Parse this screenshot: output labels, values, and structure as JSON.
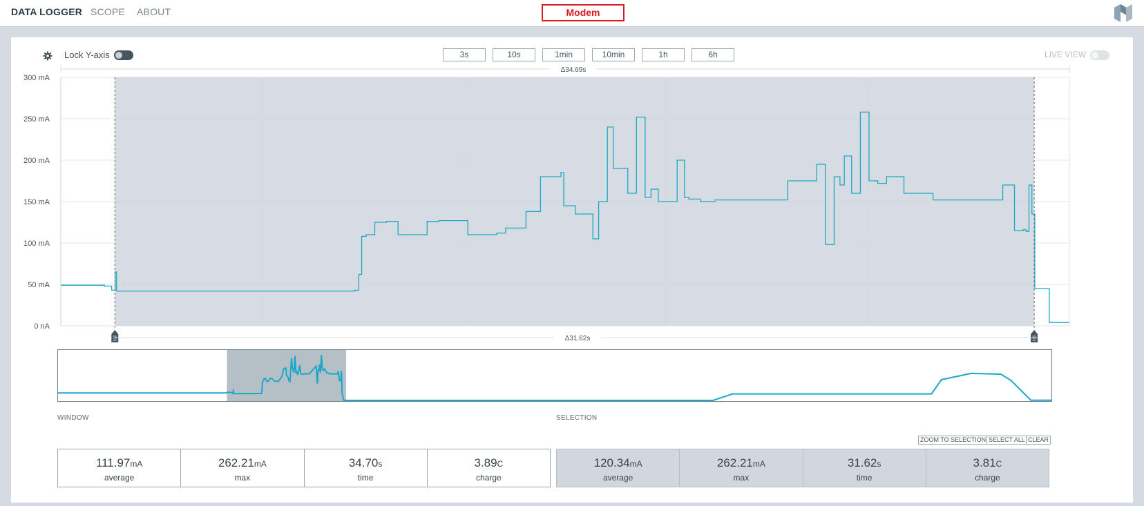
{
  "nav": {
    "items": [
      "DATA LOGGER",
      "SCOPE",
      "ABOUT"
    ],
    "device_name": "Modem"
  },
  "toolbar": {
    "lock_y_label": "Lock Y-axis",
    "live_view_label": "LIVE VIEW",
    "ranges": [
      "3s",
      "10s",
      "1min",
      "10min",
      "1h",
      "6h"
    ],
    "lock_y_on": true,
    "live_view_on": false
  },
  "chart": {
    "window_delta": "Δ34.69s",
    "selection_delta": "Δ31.62s",
    "accent": "#1ba8c8",
    "selection_fill": "#cfd6dc"
  },
  "chart_data": {
    "type": "line",
    "ylabel": "",
    "y_ticks": [
      "300 mA",
      "250 mA",
      "200 mA",
      "150 mA",
      "100 mA",
      "50 mA",
      "0 nA"
    ],
    "ylim": [
      0,
      300
    ],
    "xlim": [
      0,
      34.69
    ],
    "selection": [
      1.86,
      33.48
    ],
    "grid": true,
    "series": [
      {
        "x": [
          0,
          1.5,
          1.6,
          1.75,
          1.84,
          1.87,
          1.92,
          2.2,
          5,
          8,
          10.1,
          10.25,
          10.35,
          10.5,
          10.8,
          11.2,
          11.6,
          12,
          12.6,
          13,
          14,
          15,
          15.3,
          16,
          16.5,
          17.2,
          17.3,
          17.7,
          18.3,
          18.5,
          18.8,
          19,
          19.5,
          19.8,
          20.1,
          20.3,
          20.55,
          20.7,
          21.2,
          21.45,
          21.6,
          22,
          22.5,
          23,
          24,
          25,
          26,
          26.3,
          26.6,
          26.8,
          26.95,
          27.2,
          27.5,
          27.8,
          28.1,
          28.4,
          29,
          30,
          31,
          32,
          32.3,
          32.4,
          32.8,
          33.1,
          33.2,
          33.3,
          33.4,
          33.5,
          34,
          34.69
        ],
        "y": [
          49,
          48,
          48,
          43,
          43,
          65,
          42,
          42,
          42,
          42,
          43,
          62,
          108,
          110,
          125,
          126,
          110,
          110,
          126,
          127,
          110,
          112,
          118,
          138,
          180,
          185,
          145,
          135,
          105,
          150,
          240,
          190,
          160,
          252,
          155,
          165,
          150,
          150,
          200,
          155,
          153,
          150,
          152,
          152,
          152,
          175,
          195,
          98,
          180,
          170,
          205,
          160,
          258,
          175,
          172,
          180,
          160,
          152,
          152,
          152,
          152,
          170,
          115,
          116,
          114,
          170,
          135,
          45,
          4,
          4
        ]
      }
    ]
  },
  "minimap": {
    "viewport_range": [
      0.17,
      0.29
    ]
  },
  "window_stats": {
    "label": "WINDOW",
    "cells": [
      {
        "value": "111.97",
        "unit": "mA",
        "name": "average"
      },
      {
        "value": "262.21",
        "unit": "mA",
        "name": "max"
      },
      {
        "value": "34.70",
        "unit": "s",
        "name": "time"
      },
      {
        "value": "3.89",
        "unit": "C",
        "name": "charge"
      }
    ]
  },
  "selection_stats": {
    "label": "SELECTION",
    "zoom_label": "ZOOM TO SELECTION",
    "select_all_label": "SELECT ALL",
    "clear_label": "CLEAR",
    "cells": [
      {
        "value": "120.34",
        "unit": "mA",
        "name": "average"
      },
      {
        "value": "262.21",
        "unit": "mA",
        "name": "max"
      },
      {
        "value": "31.62",
        "unit": "s",
        "name": "time"
      },
      {
        "value": "3.81",
        "unit": "C",
        "name": "charge"
      }
    ]
  }
}
